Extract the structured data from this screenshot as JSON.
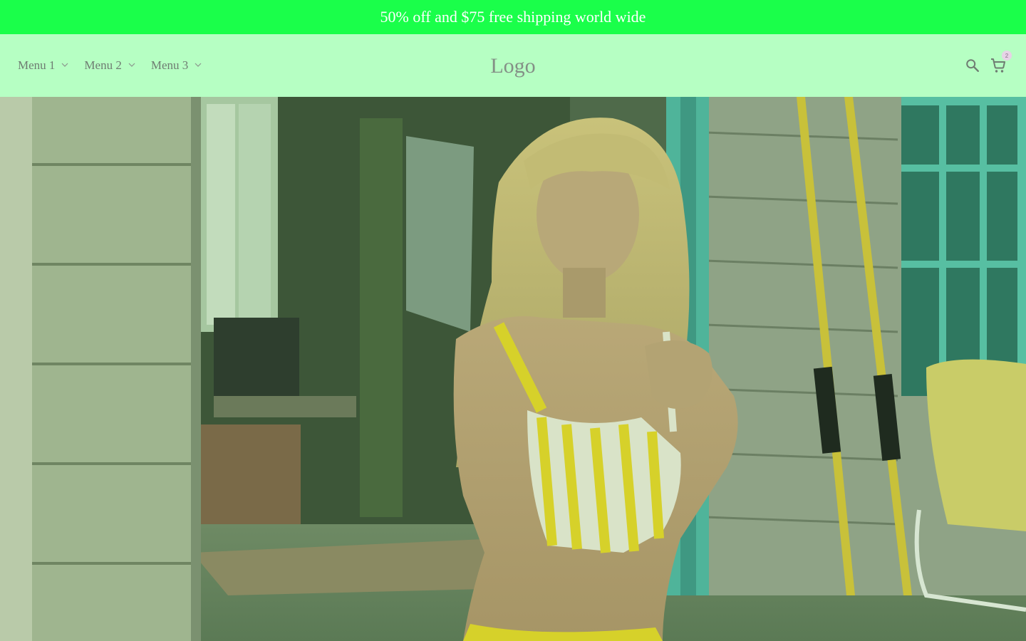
{
  "announcement": {
    "text": "50% off and $75 free shipping world wide"
  },
  "header": {
    "menu": [
      {
        "label": "Menu 1"
      },
      {
        "label": "Menu 2"
      },
      {
        "label": "Menu 3"
      }
    ],
    "logo": "Logo",
    "cart_count": "2",
    "icons": {
      "search": "search-icon",
      "cart": "shopping-cart-icon",
      "dropdown": "chevron-down-icon"
    }
  },
  "hero": {
    "image": "woman-in-striped-swimsuit-on-porch"
  },
  "colors": {
    "announcement_bg": "#1aff4a",
    "header_bg": "#b6ffc3",
    "nav_text": "#6f7c72"
  }
}
